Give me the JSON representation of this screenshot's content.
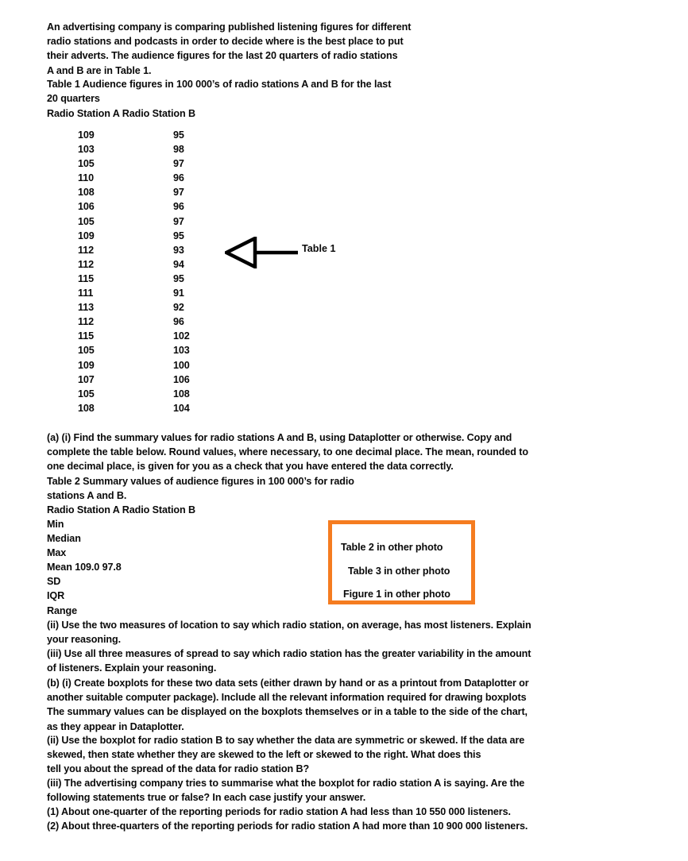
{
  "document": {
    "intro": "An advertising company is comparing published listening figures for different\nradio stations and podcasts in order to decide where is the best place to put\ntheir adverts. The audience figures for the last 20 quarters of radio stations\nA and B are in Table 1.",
    "table1_caption": "Table 1 Audience figures in 100 000’s of radio stations A and B for the last\n20 quarters",
    "table1_header": "Radio Station A Radio Station B",
    "part_a_i": "(a) (i) Find the summary values for radio stations A and B, using Dataplotter or otherwise. Copy and\ncomplete the table below. Round values, where necessary, to one decimal place. The mean, rounded to\none decimal place, is given for you as a check that you have entered the data correctly.",
    "table2_caption": "Table 2 Summary values of audience figures in 100 000’s for radio\nstations A and B.",
    "table2_header": "Radio Station A Radio Station B",
    "part_a_ii": "(ii) Use the two measures of location to say which radio station, on average, has most listeners. Explain\nyour reasoning.",
    "part_a_iii": "(iii) Use all three measures of spread to say which radio station has the greater variability in the amount\nof listeners. Explain your reasoning.",
    "part_b_i": "(b) (i) Create boxplots for these two data sets (either drawn by hand or as a printout from Dataplotter or\nanother suitable computer package). Include all the relevant information required for drawing boxplots\nThe summary values can be displayed on the boxplots themselves or in a table to the side of the chart,\nas they appear in Dataplotter.",
    "part_b_ii": "(ii) Use the boxplot for radio station B to say whether the data are symmetric or skewed. If the data are\nskewed, then state whether they are skewed to the left or skewed to the right. What does this\ntell you about the spread of the data for radio station B?",
    "part_b_iii": "(iii) The advertising company tries to summarise what the boxplot for radio station A is saying. Are the\nfollowing statements true or false? In each case justify your answer.",
    "statement_1": "(1) About one-quarter of the reporting periods for radio station A had less than 10 550 000 listeners.",
    "statement_2": "(2) About three-quarters of the reporting periods for radio station A had more than 10 900 000 listeners."
  },
  "annotation": {
    "arrow_label": "Table 1",
    "arrow_icon": "left-arrow-outline-icon"
  },
  "callout": {
    "border_color": "#F57C20",
    "lines": [
      "Table 2 in other photo",
      "Table 3 in other photo",
      "Figure 1 in other photo"
    ]
  },
  "chart_data": {
    "type": "table",
    "title": "Table 1 Audience figures in 100 000’s of radio stations A and B for the last 20 quarters",
    "columns": [
      "Radio Station A",
      "Radio Station B"
    ],
    "rows": [
      [
        "109",
        "95"
      ],
      [
        "103",
        "98"
      ],
      [
        "105",
        "97"
      ],
      [
        "110",
        "96"
      ],
      [
        "108",
        "97"
      ],
      [
        "106",
        "96"
      ],
      [
        "105",
        "97"
      ],
      [
        "109",
        "95"
      ],
      [
        "112",
        "93"
      ],
      [
        "112",
        "94"
      ],
      [
        "115",
        "95"
      ],
      [
        "111",
        "91"
      ],
      [
        "113",
        "92"
      ],
      [
        "112",
        "96"
      ],
      [
        "115",
        "102"
      ],
      [
        "105",
        "103"
      ],
      [
        "109",
        "100"
      ],
      [
        "107",
        "106"
      ],
      [
        "105",
        "108"
      ],
      [
        "108",
        "104"
      ]
    ],
    "series": [
      {
        "name": "Radio Station A",
        "values": [
          109,
          103,
          105,
          110,
          108,
          106,
          105,
          109,
          112,
          112,
          115,
          111,
          113,
          112,
          115,
          105,
          109,
          107,
          105,
          108
        ]
      },
      {
        "name": "Radio Station B",
        "values": [
          95,
          98,
          97,
          96,
          97,
          96,
          97,
          95,
          93,
          94,
          95,
          91,
          92,
          96,
          102,
          103,
          100,
          106,
          108,
          104
        ]
      }
    ],
    "units": "100 000's of listeners"
  },
  "summary_table": {
    "title": "Table 2 Summary values of audience figures in 100 000's for radio stations A and B.",
    "columns": [
      "Radio Station A",
      "Radio Station B"
    ],
    "rows": [
      {
        "label": "Min",
        "text": "Min"
      },
      {
        "label": "Median",
        "text": "Median"
      },
      {
        "label": "Max",
        "text": "Max"
      },
      {
        "label": "Mean",
        "text": "Mean 109.0 97.8",
        "a": "109.0",
        "b": "97.8"
      },
      {
        "label": "SD",
        "text": "SD"
      },
      {
        "label": "IQR",
        "text": "IQR"
      },
      {
        "label": "Range",
        "text": "Range"
      }
    ]
  }
}
